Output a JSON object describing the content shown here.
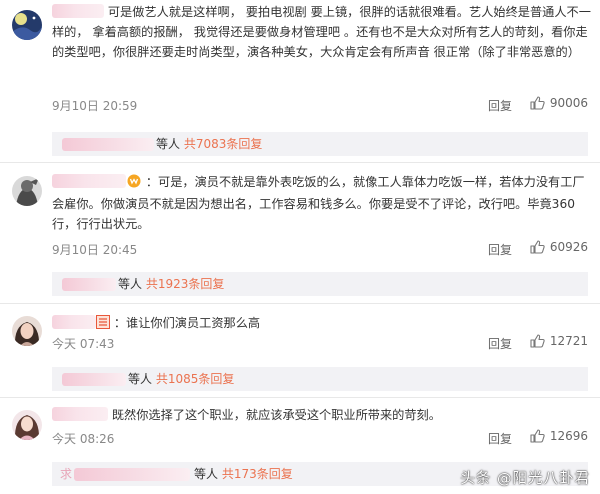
{
  "comments": [
    {
      "text": "可是做艺人就是这样啊， 要拍电视剧 要上镜，很胖的话就很难看。艺人始终是普通人不一样的， 拿着高额的报酬， 我觉得还是要做身材管理吧 。还有也不是大众对所有艺人的苛刻，看你走的类型吧，你很胖还要走时尚类型，演各种美女，大众肯定会有所声音 很正常（除了非常恶意的）",
      "time": "9月10日 20:59",
      "reply_label": "回复",
      "likes": "90006",
      "reply_summary": {
        "suffix": "等人",
        "count": "共7083条回复"
      }
    },
    {
      "text": "：可是，演员不就是靠外表吃饭的么，就像工人靠体力吃饭一样，若体力没有工厂会雇你。你做演员不就是因为想出名，工作容易和钱多么。你要是受不了评论，改行吧。毕竟360行，行行出状元。",
      "time": "9月10日 20:45",
      "reply_label": "回复",
      "likes": "60926",
      "reply_summary": {
        "suffix": "等人",
        "count": "共1923条回复"
      }
    },
    {
      "text": "：谁让你们演员工资那么高",
      "time": "今天 07:43",
      "reply_label": "回复",
      "likes": "12721",
      "reply_summary": {
        "suffix": "等人",
        "count": "共1085条回复"
      }
    },
    {
      "text": "既然你选择了这个职业，就应该承受这个职业所带来的苛刻。",
      "time": "今天 08:26",
      "reply_label": "回复",
      "likes": "12696",
      "reply_summary": {
        "prefix": "求",
        "suffix": "等人",
        "count": "共173条回复"
      }
    }
  ],
  "watermark": "头条 @阳光八卦君",
  "colors": {
    "accent": "#eb7350",
    "reply_bg": "#f2f2f5",
    "meta": "#888888"
  },
  "icons": {
    "like": "thumbs-up-icon"
  }
}
